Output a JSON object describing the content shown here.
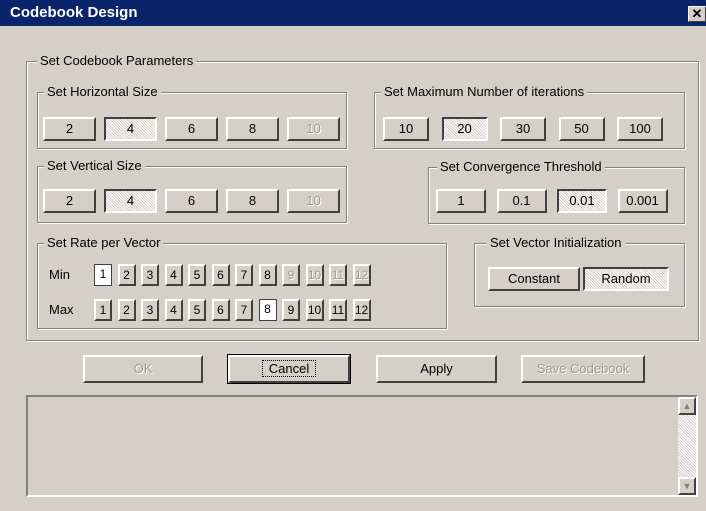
{
  "window": {
    "title": "Codebook Design",
    "close_label": "✕"
  },
  "main": {
    "legend": "Set Codebook Parameters"
  },
  "horizontal": {
    "legend": "Set Horizontal Size",
    "options": [
      "2",
      "4",
      "6",
      "8",
      "10"
    ],
    "selected": "4",
    "disabled": [
      "10"
    ]
  },
  "vertical": {
    "legend": "Set Vertical Size",
    "options": [
      "2",
      "4",
      "6",
      "8",
      "10"
    ],
    "selected": "4",
    "disabled": [
      "10"
    ]
  },
  "iterations": {
    "legend": "Set Maximum Number of iterations",
    "options": [
      "10",
      "20",
      "30",
      "50",
      "100"
    ],
    "selected": "20"
  },
  "threshold": {
    "legend": "Set Convergence Threshold",
    "options": [
      "1",
      "0.1",
      "0.01",
      "0.001"
    ],
    "selected": "0.01"
  },
  "rate": {
    "legend": "Set Rate per Vector",
    "min_label": "Min",
    "max_label": "Max",
    "options": [
      "1",
      "2",
      "3",
      "4",
      "5",
      "6",
      "7",
      "8",
      "9",
      "10",
      "11",
      "12"
    ],
    "min_selected": "1",
    "min_disabled": [
      "9",
      "10",
      "11",
      "12"
    ],
    "max_selected": "8"
  },
  "init": {
    "legend": "Set Vector Initialization",
    "options": [
      "Constant",
      "Random"
    ],
    "selected": "Random"
  },
  "actions": {
    "ok": "OK",
    "cancel": "Cancel",
    "apply": "Apply",
    "save": "Save Codebook"
  },
  "scrollbar": {
    "up": "▲",
    "down": "▼"
  }
}
